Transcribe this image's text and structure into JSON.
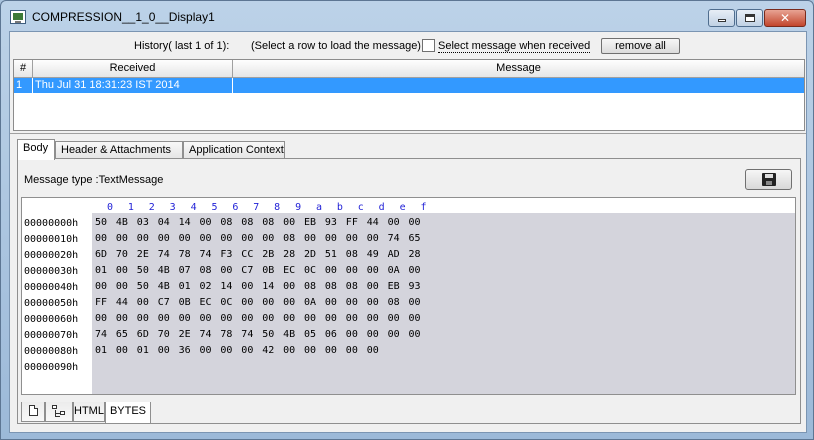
{
  "window": {
    "title": "COMPRESSION__1_0__Display1",
    "close_glyph": "✕"
  },
  "history": {
    "label": "History( last 1 of 1):",
    "hint": "(Select a row to load the message)",
    "checkbox_label": "Select message when received",
    "checkbox_checked": false,
    "remove_all_label": "remove all"
  },
  "table": {
    "columns": [
      "#",
      "Received",
      "Message"
    ],
    "rows": [
      {
        "index": "1",
        "received": "Thu Jul 31 18:31:23 IST 2014",
        "message": ""
      }
    ]
  },
  "tabs": [
    "Body",
    "Header & Attachments",
    "Application Context"
  ],
  "active_tab": "Body",
  "body": {
    "message_type": "Message type :TextMessage",
    "save_icon": "floppy-disk-icon"
  },
  "hex": {
    "columns": [
      "0",
      "1",
      "2",
      "3",
      "4",
      "5",
      "6",
      "7",
      "8",
      "9",
      "a",
      "b",
      "c",
      "d",
      "e",
      "f"
    ],
    "offsets": [
      "00000000h",
      "00000010h",
      "00000020h",
      "00000030h",
      "00000040h",
      "00000050h",
      "00000060h",
      "00000070h",
      "00000080h",
      "00000090h"
    ],
    "rows": [
      [
        "50",
        "4B",
        "03",
        "04",
        "14",
        "00",
        "08",
        "08",
        "08",
        "00",
        "EB",
        "93",
        "FF",
        "44",
        "00",
        "00"
      ],
      [
        "00",
        "00",
        "00",
        "00",
        "00",
        "00",
        "00",
        "00",
        "00",
        "08",
        "00",
        "00",
        "00",
        "00",
        "74",
        "65"
      ],
      [
        "6D",
        "70",
        "2E",
        "74",
        "78",
        "74",
        "F3",
        "CC",
        "2B",
        "28",
        "2D",
        "51",
        "08",
        "49",
        "AD",
        "28"
      ],
      [
        "01",
        "00",
        "50",
        "4B",
        "07",
        "08",
        "00",
        "C7",
        "0B",
        "EC",
        "0C",
        "00",
        "00",
        "00",
        "0A",
        "00"
      ],
      [
        "00",
        "00",
        "50",
        "4B",
        "01",
        "02",
        "14",
        "00",
        "14",
        "00",
        "08",
        "08",
        "08",
        "00",
        "EB",
        "93"
      ],
      [
        "FF",
        "44",
        "00",
        "C7",
        "0B",
        "EC",
        "0C",
        "00",
        "00",
        "00",
        "0A",
        "00",
        "00",
        "00",
        "08",
        "00"
      ],
      [
        "00",
        "00",
        "00",
        "00",
        "00",
        "00",
        "00",
        "00",
        "00",
        "00",
        "00",
        "00",
        "00",
        "00",
        "00",
        "00"
      ],
      [
        "74",
        "65",
        "6D",
        "70",
        "2E",
        "74",
        "78",
        "74",
        "50",
        "4B",
        "05",
        "06",
        "00",
        "00",
        "00",
        "00"
      ],
      [
        "01",
        "00",
        "01",
        "00",
        "36",
        "00",
        "00",
        "00",
        "42",
        "00",
        "00",
        "00",
        "00",
        "00"
      ],
      []
    ]
  },
  "bottom_tabs": [
    {
      "icon": "document-icon",
      "label": ""
    },
    {
      "icon": "tree-icon",
      "label": ""
    },
    {
      "icon": "",
      "label": "HTML"
    },
    {
      "icon": "",
      "label": "BYTES"
    }
  ],
  "active_bottom_tab": "BYTES"
}
